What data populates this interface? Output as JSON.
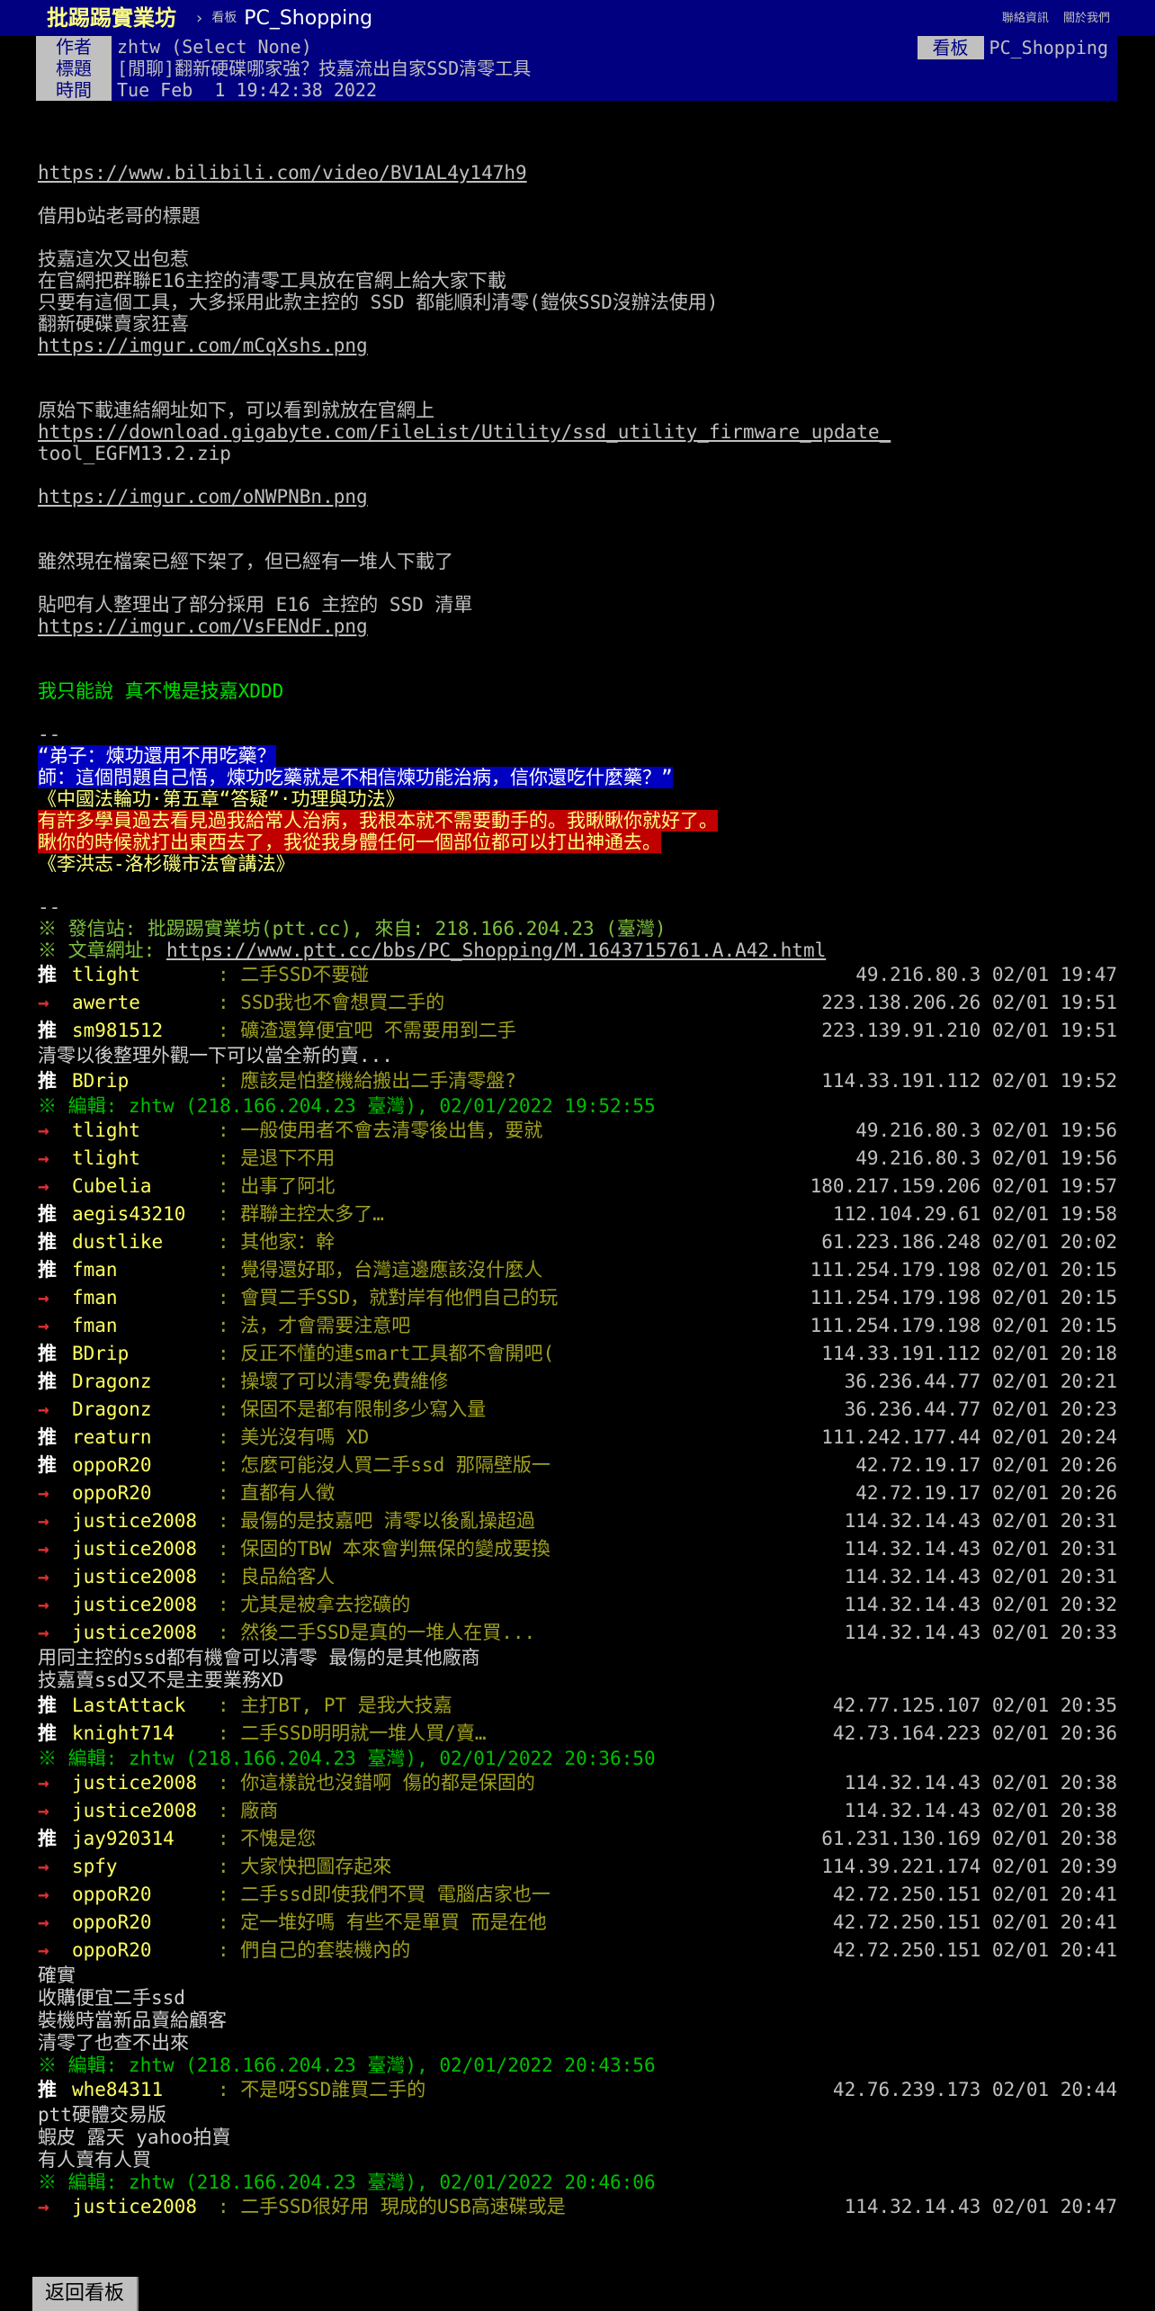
{
  "topbar": {
    "site": "批踢踢實業坊",
    "board_label": "看板",
    "board_name": "PC_Shopping",
    "links": [
      "聯絡資訊",
      "關於我們"
    ]
  },
  "meta": {
    "author_tag": "作者",
    "author": "zhtw (Select None)",
    "title_tag": "標題",
    "title": "[閒聊]翻新硬碟哪家強？技嘉流出自家SSD清零工具",
    "time_tag": "時間",
    "time": "Tue Feb  1 19:42:38 2022",
    "board_tag": "看板",
    "board": "PC_Shopping"
  },
  "body": {
    "link1": "https://www.bilibili.com/video/BV1AL4y147h9",
    "p1": "借用b站老哥的標題",
    "p2": [
      "技嘉這次又出包惹",
      "在官網把群聯E16主控的清零工具放在官網上給大家下載",
      "只要有這個工具，大多採用此款主控的 SSD 都能順利清零(鎧俠SSD沒辦法使用)",
      "翻新硬碟賣家狂喜"
    ],
    "link2": "https://imgur.com/mCqXshs.png",
    "p3": "原始下載連結網址如下，可以看到就放在官網上",
    "link3a": "https://download.gigabyte.com/FileList/Utility/ssd_utility_firmware_update_",
    "link3b": "tool_EGFM13.2.zip",
    "link4": "https://imgur.com/oNWPNBn.png",
    "p4": "雖然現在檔案已經下架了，但已經有一堆人下載了",
    "p5": "貼吧有人整理出了部分採用 E16 主控的 SSD 清單",
    "link5": "https://imgur.com/VsFENdF.png",
    "p6": "我只能說 真不愧是技嘉XDDD",
    "sig_dash": "--",
    "sig_blue1": "“弟子：煉功還用不用吃藥？",
    "sig_blue2": "師：這個問題自己悟，煉功吃藥就是不相信煉功能治病，信你還吃什麼藥？”",
    "sig_yellow1": "《中國法輪功·第五章“答疑”·功理與功法》",
    "sig_red1": "有許多學員過去看見過我給常人治病，我根本就不需要動手的。我瞅瞅你就好了。",
    "sig_red2": "瞅你的時候就打出東西去了，我從我身體任何一個部位都可以打出神通去。",
    "sig_yellow2": "《李洪志-洛杉磯市法會講法》",
    "foot_dash": "--",
    "foot_site": "※ 發信站: 批踢踢實業坊(ptt.cc), 來自: 218.166.204.23 (臺灣)",
    "foot_url_label": "※ 文章網址: ",
    "foot_url": "https://www.ptt.cc/bbs/PC_Shopping/M.1643715761.A.A42.html"
  },
  "comments": [
    {
      "type": "push",
      "tag": "推",
      "user": "tlight",
      "content": ": 二手SSD不要碰",
      "ip": "49.216.80.3 02/01 19:47"
    },
    {
      "type": "push",
      "tag": "→",
      "user": "awerte",
      "content": ": SSD我也不會想買二手的",
      "ip": "223.138.206.26 02/01 19:51"
    },
    {
      "type": "push",
      "tag": "推",
      "user": "sm981512",
      "content": ": 礦渣還算便宜吧 不需要用到二手",
      "ip": "223.139.91.210 02/01 19:51"
    },
    {
      "type": "plain",
      "text": "清零以後整理外觀一下可以當全新的賣..."
    },
    {
      "type": "push",
      "tag": "推",
      "user": "BDrip",
      "content": ": 應該是怕整機給搬出二手清零盤?",
      "ip": "114.33.191.112 02/01 19:52"
    },
    {
      "type": "edit",
      "text": "※ 編輯: zhtw (218.166.204.23 臺灣), 02/01/2022 19:52:55"
    },
    {
      "type": "push",
      "tag": "→",
      "user": "tlight",
      "content": ": 一般使用者不會去清零後出售，要就",
      "ip": "49.216.80.3 02/01 19:56"
    },
    {
      "type": "push",
      "tag": "→",
      "user": "tlight",
      "content": ": 是退下不用",
      "ip": "49.216.80.3 02/01 19:56"
    },
    {
      "type": "push",
      "tag": "→",
      "user": "Cubelia",
      "content": ": 出事了阿北",
      "ip": "180.217.159.206 02/01 19:57"
    },
    {
      "type": "push",
      "tag": "推",
      "user": "aegis43210",
      "content": ": 群聯主控太多了…",
      "ip": "112.104.29.61 02/01 19:58"
    },
    {
      "type": "push",
      "tag": "推",
      "user": "dustlike",
      "content": ": 其他家：幹",
      "ip": "61.223.186.248 02/01 20:02"
    },
    {
      "type": "push",
      "tag": "推",
      "user": "fman",
      "content": ": 覺得還好耶，台灣這邊應該沒什麼人",
      "ip": "111.254.179.198 02/01 20:15"
    },
    {
      "type": "push",
      "tag": "→",
      "user": "fman",
      "content": ": 會買二手SSD，就對岸有他們自己的玩",
      "ip": "111.254.179.198 02/01 20:15"
    },
    {
      "type": "push",
      "tag": "→",
      "user": "fman",
      "content": ": 法，才會需要注意吧",
      "ip": "111.254.179.198 02/01 20:15"
    },
    {
      "type": "push",
      "tag": "推",
      "user": "BDrip",
      "content": ": 反正不懂的連smart工具都不會開吧(",
      "ip": "114.33.191.112 02/01 20:18"
    },
    {
      "type": "push",
      "tag": "推",
      "user": "Dragonz",
      "content": ": 操壞了可以清零免費維修",
      "ip": "36.236.44.77 02/01 20:21"
    },
    {
      "type": "push",
      "tag": "→",
      "user": "Dragonz",
      "content": ": 保固不是都有限制多少寫入量",
      "ip": "36.236.44.77 02/01 20:23"
    },
    {
      "type": "push",
      "tag": "推",
      "user": "reaturn",
      "content": ": 美光沒有嗎 XD",
      "ip": "111.242.177.44 02/01 20:24"
    },
    {
      "type": "push",
      "tag": "推",
      "user": "oppoR20",
      "content": ": 怎麼可能沒人買二手ssd 那隔壁版一",
      "ip": "42.72.19.17 02/01 20:26"
    },
    {
      "type": "push",
      "tag": "→",
      "user": "oppoR20",
      "content": ": 直都有人徵",
      "ip": "42.72.19.17 02/01 20:26"
    },
    {
      "type": "push",
      "tag": "→",
      "user": "justice2008",
      "content": ": 最傷的是技嘉吧 清零以後亂操超過",
      "ip": "114.32.14.43 02/01 20:31"
    },
    {
      "type": "push",
      "tag": "→",
      "user": "justice2008",
      "content": ": 保固的TBW 本來會判無保的變成要換",
      "ip": "114.32.14.43 02/01 20:31"
    },
    {
      "type": "push",
      "tag": "→",
      "user": "justice2008",
      "content": ": 良品給客人",
      "ip": "114.32.14.43 02/01 20:31"
    },
    {
      "type": "push",
      "tag": "→",
      "user": "justice2008",
      "content": ": 尤其是被拿去挖礦的",
      "ip": "114.32.14.43 02/01 20:32"
    },
    {
      "type": "push",
      "tag": "→",
      "user": "justice2008",
      "content": ": 然後二手SSD是真的一堆人在買...",
      "ip": "114.32.14.43 02/01 20:33"
    },
    {
      "type": "plain",
      "text": "用同主控的ssd都有機會可以清零 最傷的是其他廠商"
    },
    {
      "type": "plain",
      "text": "技嘉賣ssd又不是主要業務XD"
    },
    {
      "type": "push",
      "tag": "推",
      "user": "LastAttack",
      "content": ": 主打BT, PT 是我大技嘉",
      "ip": "42.77.125.107 02/01 20:35"
    },
    {
      "type": "push",
      "tag": "推",
      "user": "knight714",
      "content": ": 二手SSD明明就一堆人買/賣…",
      "ip": "42.73.164.223 02/01 20:36"
    },
    {
      "type": "edit",
      "text": "※ 編輯: zhtw (218.166.204.23 臺灣), 02/01/2022 20:36:50"
    },
    {
      "type": "push",
      "tag": "→",
      "user": "justice2008",
      "content": ": 你這樣說也沒錯啊 傷的都是保固的",
      "ip": "114.32.14.43 02/01 20:38"
    },
    {
      "type": "push",
      "tag": "→",
      "user": "justice2008",
      "content": ": 廠商",
      "ip": "114.32.14.43 02/01 20:38"
    },
    {
      "type": "push",
      "tag": "推",
      "user": "jay920314",
      "content": ": 不愧是您",
      "ip": "61.231.130.169 02/01 20:38"
    },
    {
      "type": "push",
      "tag": "→",
      "user": "spfy",
      "content": ": 大家快把圖存起來",
      "ip": "114.39.221.174 02/01 20:39"
    },
    {
      "type": "push",
      "tag": "→",
      "user": "oppoR20",
      "content": ": 二手ssd即使我們不買 電腦店家也一",
      "ip": "42.72.250.151 02/01 20:41"
    },
    {
      "type": "push",
      "tag": "→",
      "user": "oppoR20",
      "content": ": 定一堆好嗎 有些不是單買 而是在他",
      "ip": "42.72.250.151 02/01 20:41"
    },
    {
      "type": "push",
      "tag": "→",
      "user": "oppoR20",
      "content": ": 們自己的套裝機內的",
      "ip": "42.72.250.151 02/01 20:41"
    },
    {
      "type": "plain",
      "text": "確實"
    },
    {
      "type": "plain",
      "text": "收購便宜二手ssd"
    },
    {
      "type": "plain",
      "text": "裝機時當新品賣給顧客"
    },
    {
      "type": "plain",
      "text": "清零了也查不出來"
    },
    {
      "type": "edit",
      "text": "※ 編輯: zhtw (218.166.204.23 臺灣), 02/01/2022 20:43:56"
    },
    {
      "type": "push",
      "tag": "推",
      "user": "whe84311",
      "content": ": 不是呀SSD誰買二手的",
      "ip": "42.76.239.173 02/01 20:44"
    },
    {
      "type": "plain",
      "text": "ptt硬體交易版"
    },
    {
      "type": "plain",
      "text": "蝦皮 露天 yahoo拍賣"
    },
    {
      "type": "plain",
      "text": "有人賣有人買"
    },
    {
      "type": "edit",
      "text": "※ 編輯: zhtw (218.166.204.23 臺灣), 02/01/2022 20:46:06"
    },
    {
      "type": "push",
      "tag": "→",
      "user": "justice2008",
      "content": ": 二手SSD很好用 現成的USB高速碟或是",
      "ip": "114.32.14.43 02/01 20:47"
    }
  ],
  "bottom": {
    "back_label": "返回看板"
  }
}
